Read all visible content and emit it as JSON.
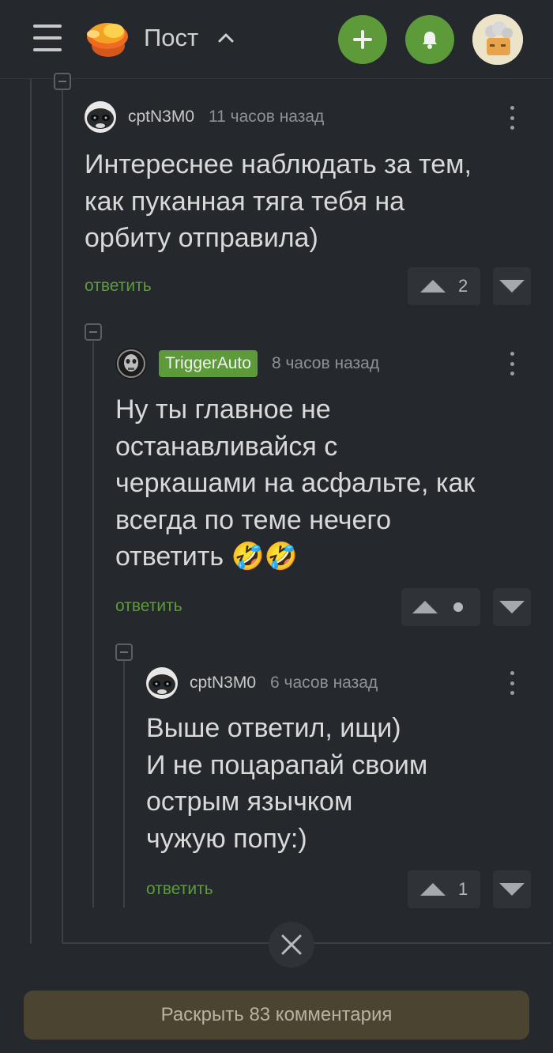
{
  "header": {
    "title": "Пост",
    "add_icon": "plus-icon",
    "bell_icon": "bell-icon",
    "accent": "#5d9a3a"
  },
  "comments": [
    {
      "user": "cptN3M0",
      "time": "11 часов назад",
      "text": "Интереснее наблюдать за тем,\nкак пуканная тяга тебя на\nорбиту отправила)",
      "reply": "ответить",
      "votes": "2"
    },
    {
      "user": "TriggerAuto",
      "time": "8 часов назад",
      "text": "Ну ты главное не\nостанавливайся с\nчеркашами на асфальте, как\nвсегда по теме нечего\nответить 🤣🤣",
      "reply": "ответить",
      "votes": ""
    },
    {
      "user": "cptN3M0",
      "time": "6 часов назад",
      "text": "Выше ответил, ищи)\nИ не поцарапай своим\nострым язычком\nчужую попу:)",
      "reply": "ответить",
      "votes": "1"
    }
  ],
  "footer": {
    "expand_label": "Раскрыть 83 комментария",
    "expand_color": "#4a4431"
  }
}
